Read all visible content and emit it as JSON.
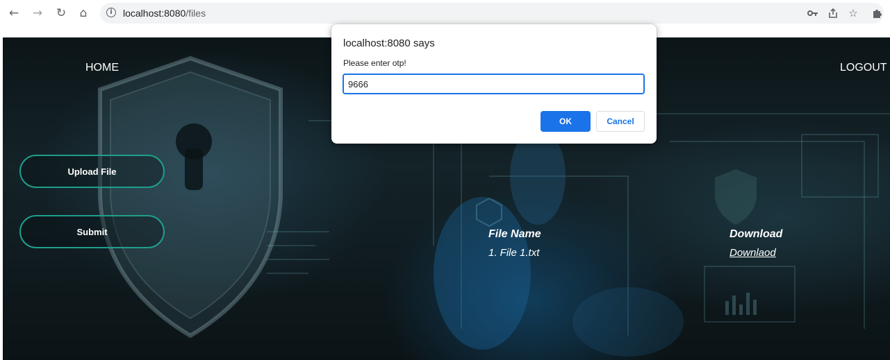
{
  "browser": {
    "url_host": "localhost:8080",
    "url_path": "/files",
    "icons": {
      "back": "back-arrow-icon",
      "forward": "forward-arrow-icon",
      "reload": "reload-icon",
      "home": "home-icon",
      "site_info": "info-icon",
      "password": "key-icon",
      "share": "share-icon",
      "bookmark": "star-icon",
      "extensions": "puzzle-icon"
    }
  },
  "nav": {
    "home_label": "HOME",
    "logout_label": "LOGOUT"
  },
  "actions": {
    "upload_label": "Upload File",
    "submit_label": "Submit"
  },
  "files": {
    "columns": {
      "name": "File Name",
      "download": "Download"
    },
    "rows": [
      {
        "name": "1. File 1.txt",
        "download": "Downlaod"
      }
    ]
  },
  "dialog": {
    "title": "localhost:8080 says",
    "message": "Please enter otp!",
    "input_value": "9666",
    "ok_label": "OK",
    "cancel_label": "Cancel"
  },
  "colors": {
    "accent_blue": "#1a73e8",
    "button_border_teal": "#1f9e8c",
    "page_background": "#0f1b1f"
  }
}
